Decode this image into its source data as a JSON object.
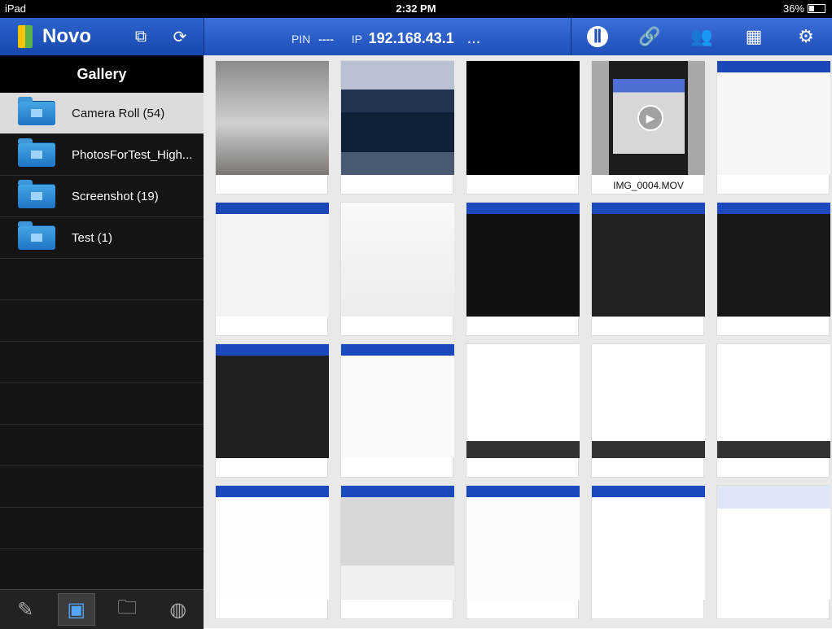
{
  "status_bar": {
    "device": "iPad",
    "time": "2:32 PM",
    "battery": "36%"
  },
  "top_bar": {
    "brand": "Novo",
    "pin_label": "PIN",
    "pin_value": "----",
    "ip_label": "IP",
    "ip_value": "192.168.43.1",
    "ellipsis": "...",
    "icons": [
      "screen-share-icon",
      "refresh-icon",
      "pause-icon",
      "link-icon",
      "users-icon",
      "grid-icon",
      "gear-icon"
    ]
  },
  "sidebar": {
    "title": "Gallery",
    "albums": [
      {
        "label": "Camera Roll (54)",
        "selected": true
      },
      {
        "label": "PhotosForTest_High...",
        "selected": false
      },
      {
        "label": "Screenshot (19)",
        "selected": false
      },
      {
        "label": "Test (1)",
        "selected": false
      }
    ],
    "bottom_tools": [
      "pencil-icon",
      "gallery-icon",
      "folder-icon",
      "globe-icon"
    ]
  },
  "thumbnails": [
    {
      "caption": ""
    },
    {
      "caption": ""
    },
    {
      "caption": ""
    },
    {
      "caption": "IMG_0004.MOV"
    },
    {
      "caption": ""
    },
    {
      "caption": ""
    },
    {
      "caption": ""
    },
    {
      "caption": ""
    },
    {
      "caption": ""
    },
    {
      "caption": ""
    },
    {
      "caption": ""
    },
    {
      "caption": ""
    },
    {
      "caption": ""
    },
    {
      "caption": ""
    },
    {
      "caption": ""
    },
    {
      "caption": ""
    },
    {
      "caption": ""
    },
    {
      "caption": ""
    },
    {
      "caption": ""
    },
    {
      "caption": ""
    }
  ]
}
